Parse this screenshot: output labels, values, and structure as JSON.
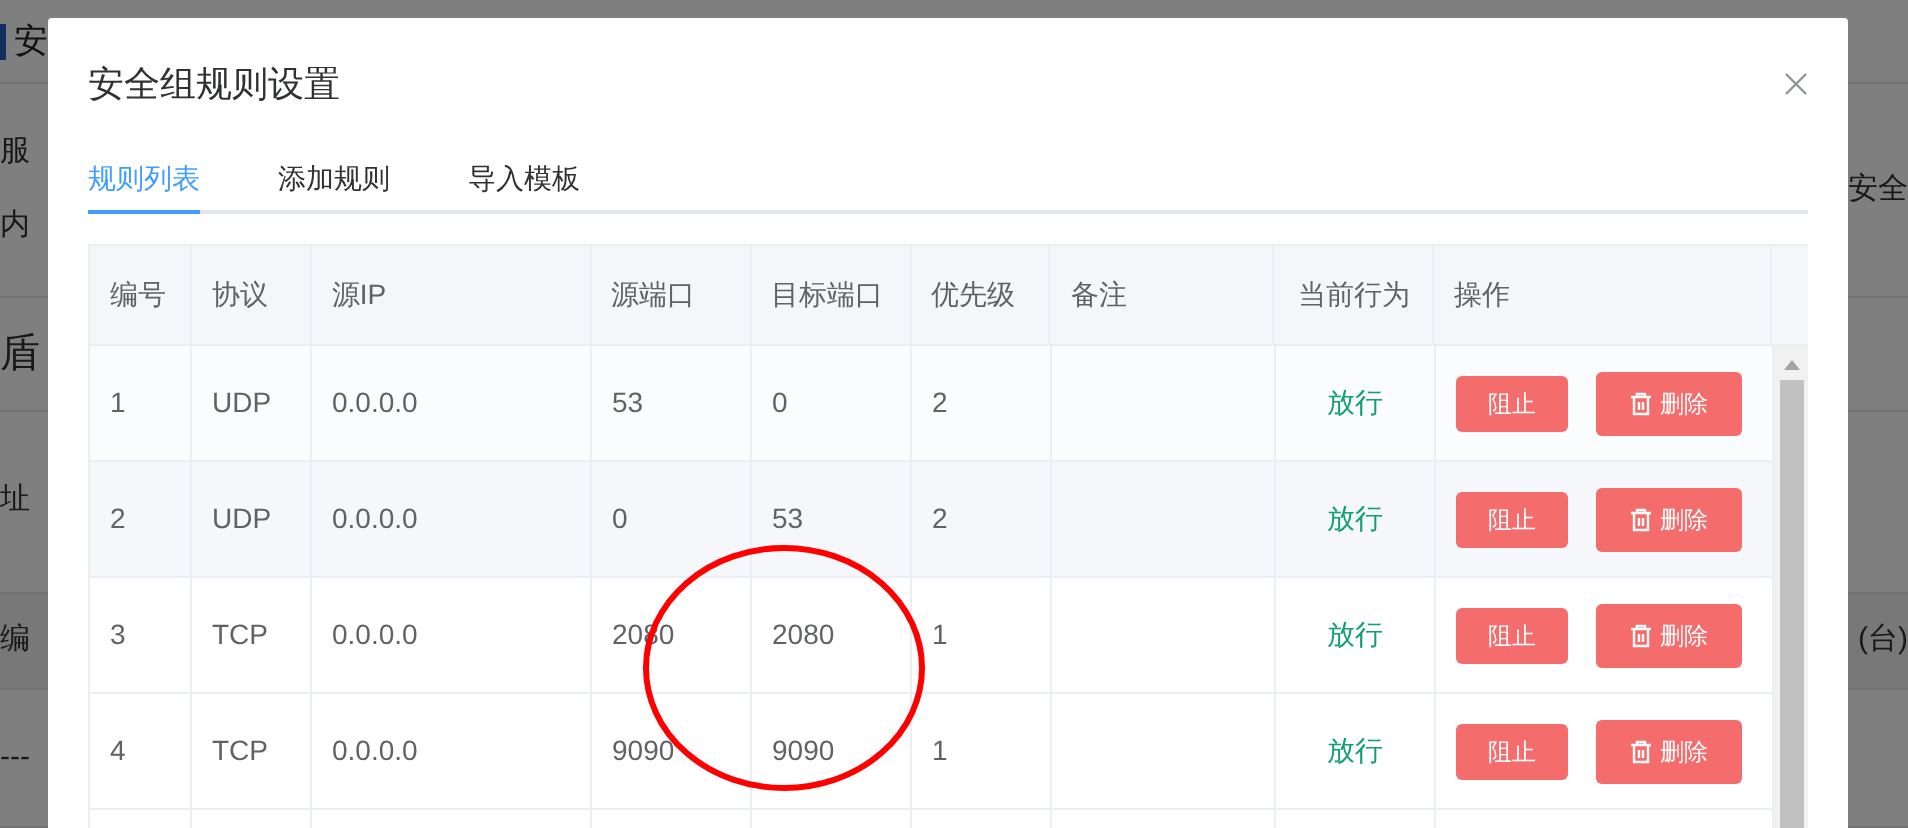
{
  "background": {
    "header_title": "安",
    "left_labels": [
      "服",
      "内",
      "盾",
      "址",
      "编",
      "---"
    ],
    "right_labels": [
      "安全",
      "(台)"
    ]
  },
  "dialog": {
    "title": "安全组规则设置",
    "tabs": [
      {
        "label": "规则列表",
        "selected": true
      },
      {
        "label": "添加规则",
        "selected": false
      },
      {
        "label": "导入模板",
        "selected": false
      }
    ],
    "table": {
      "columns": [
        "编号",
        "协议",
        "源IP",
        "源端口",
        "目标端口",
        "优先级",
        "备注",
        "当前行为",
        "操作"
      ],
      "rows": [
        {
          "cells": [
            "1",
            "UDP",
            "0.0.0.0",
            "53",
            "0",
            "2"
          ],
          "action": "放行",
          "buttons": [
            "阻止",
            "删除"
          ]
        },
        {
          "cells": [
            "2",
            "UDP",
            "0.0.0.0",
            "0",
            "53",
            "2"
          ],
          "action": "放行",
          "buttons": [
            "阻止",
            "删除"
          ]
        },
        {
          "cells": [
            "3",
            "TCP",
            "0.0.0.0",
            "2080",
            "2080",
            "1"
          ],
          "action": "放行",
          "buttons": [
            "阻止",
            "删除"
          ]
        },
        {
          "cells": [
            "4",
            "TCP",
            "0.0.0.0",
            "9090",
            "9090",
            "1"
          ],
          "action": "放行",
          "buttons": [
            "阻止",
            "删除"
          ]
        }
      ]
    }
  }
}
